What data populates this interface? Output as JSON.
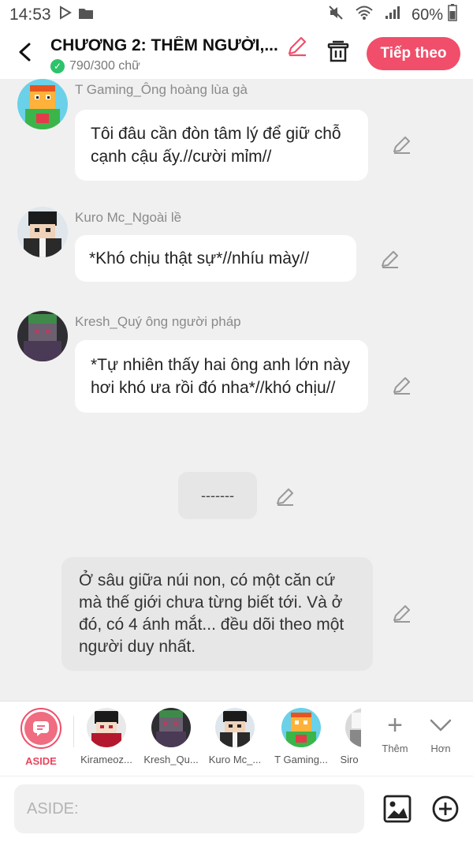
{
  "status_bar": {
    "time": "14:53",
    "battery": "60%",
    "icons": [
      "play-icon",
      "folder-icon",
      "mute-icon",
      "wifi-icon",
      "signal-icon",
      "battery-icon"
    ]
  },
  "header": {
    "title": "CHƯƠNG 2: THÊM NGƯỜI,...",
    "word_count": "790/300 chữ",
    "next_label": "Tiếp theo",
    "accent_color": "#f04e6a"
  },
  "messages": [
    {
      "sender": "T Gaming_Ông hoàng lùa gà",
      "text": "Tôi đâu cần đòn tâm lý để giữ chỗ cạnh cậu ấy.//cười mỉm//"
    },
    {
      "sender": "Kuro Mc_Ngoài lề",
      "text": "*Khó chịu thật sự*//nhíu mày//"
    },
    {
      "sender": "Kresh_Quý ông người pháp",
      "text": "*Tự nhiên thấy hai ông anh lớn này hơi khó ưa rồi đó nha*//khó chịu//"
    }
  ],
  "divider_text": "-------",
  "aside_text": "Ở sâu giữa núi non, có một căn cứ mà thế giới chưa từng biết tới. Và ở đó, có 4 ánh mắt... đều dõi theo một người duy nhất.",
  "characters": {
    "aside_label": "ASIDE",
    "items": [
      {
        "name": "Kirameoz..."
      },
      {
        "name": "Kresh_Qu..."
      },
      {
        "name": "Kuro Mc_..."
      },
      {
        "name": "T Gaming..."
      },
      {
        "name": "Siro"
      }
    ],
    "more_label": "Thêm",
    "expand_label": "Hơn"
  },
  "input": {
    "placeholder": "ASIDE:"
  }
}
